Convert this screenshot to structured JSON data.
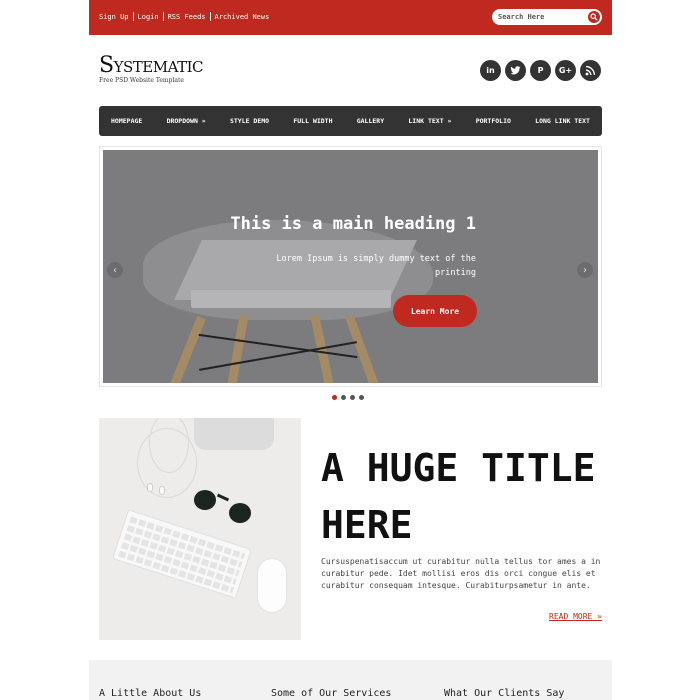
{
  "topbar": {
    "links": [
      "Sign Up",
      "Login",
      "RSS Feeds",
      "Archived News"
    ],
    "search_placeholder": "Search Here",
    "accent_color": "#c0291f"
  },
  "header": {
    "logo": "Systematic",
    "tagline": "Free PSD Website Template",
    "social_icons": [
      "linkedin-icon",
      "twitter-icon",
      "pinterest-icon",
      "google-plus-icon",
      "rss-icon"
    ],
    "social_labels": {
      "linkedin": "in",
      "pinterest": "P",
      "google_plus": "G+"
    }
  },
  "nav": {
    "items": [
      "HOMEPAGE",
      "DROPDOWN »",
      "STYLE DEMO",
      "FULL WIDTH",
      "GALLERY",
      "LINK TEXT »",
      "PORTFOLIO",
      "LONG LINK TEXT"
    ]
  },
  "slider": {
    "heading": "This is a main heading 1",
    "subtext": "Lorem Ipsum is simply dummy text of the printing",
    "button": "Learn More",
    "prev": "‹",
    "next": "›",
    "dots": 4,
    "active_dot": 0
  },
  "feature": {
    "title": "A HUGE TITLE HERE",
    "text": "Cursuspenatisaccum ut curabitur nulla tellus tor ames a in curabitur pede. Idet mollisi eros dis orci congue elis et curabitur consequam intesque. Curabiturpsametur in ante.",
    "read_more": "READ MORE »"
  },
  "footer": {
    "headings": [
      "A Little About Us",
      "Some of Our Services",
      "What Our Clients Say"
    ]
  }
}
